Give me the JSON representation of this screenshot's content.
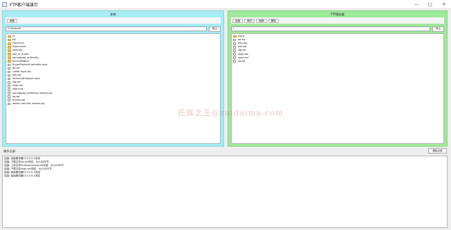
{
  "window": {
    "title": "FTP客户端演示",
    "controls": {
      "minimize": "—",
      "maximize": "□",
      "close": "✕"
    }
  },
  "local": {
    "title": "本地",
    "toolbar": [
      "刷新"
    ],
    "path": "D:\\idework",
    "up_label": "向上",
    "items": [
      {
        "name": "cc",
        "icon": "folder-icon"
      },
      {
        "name": "E6",
        "icon": "folder-icon"
      },
      {
        "name": "FtpClient",
        "icon": "folder-icon"
      },
      {
        "name": "ftpreceiver",
        "icon": "folder-icon"
      },
      {
        "name": "sellmao",
        "icon": "folder-icon"
      },
      {
        "name": "sell_m_finest",
        "icon": "folder-icon"
      },
      {
        "name": "springboot_authority",
        "icon": "folder-icon"
      },
      {
        "name": "SpringProject",
        "icon": "folder-icon"
      },
      {
        "name": "BuyerProductController.java",
        "icon": "file-icon"
      },
      {
        "name": "dd.txt",
        "icon": "file-icon"
      },
      {
        "name": "i-fetal-layui.zip",
        "icon": "file-icon"
      },
      {
        "name": "sell.sql",
        "icon": "file-icon"
      },
      {
        "name": "SellerAuthAspect.java",
        "icon": "file-icon"
      },
      {
        "name": "sfg.txt",
        "icon": "file-icon"
      },
      {
        "name": "shgh.txt",
        "icon": "file-icon"
      },
      {
        "name": "sport.txt",
        "icon": "file-icon"
      },
      {
        "name": "springboot_authority-master.zip",
        "icon": "file-icon"
      },
      {
        "name": "sq.sql",
        "icon": "file-icon"
      },
      {
        "name": "tickets.sql",
        "icon": "file-icon"
      },
      {
        "name": "weixin-sell-sell-master.zip",
        "icon": "file-icon"
      }
    ]
  },
  "remote": {
    "title": "FTP服务器",
    "toolbar": [
      "连接",
      "断开",
      "刷新",
      "删除"
    ],
    "path": "/",
    "up_label": "向上",
    "items": [
      {
        "name": "dwrg",
        "icon": "folder-icon"
      },
      {
        "name": "dd.txt",
        "icon": "file-icon"
      },
      {
        "name": "oos.doc",
        "icon": "file-icon"
      },
      {
        "name": "sell.sql",
        "icon": "file-icon"
      },
      {
        "name": "sfg.txt",
        "icon": "file-icon"
      },
      {
        "name": "shgh.txt",
        "icon": "file-icon"
      },
      {
        "name": "sport.txt",
        "icon": "file-icon"
      },
      {
        "name": "sq.sql",
        "icon": "file-icon"
      }
    ]
  },
  "watermark": "氏族之王@zuidaima.com",
  "log": {
    "label": "操作记录:",
    "clear_label": "清除记录",
    "lines": [
      "连接: 连接服务器127.0.0.1完成",
      "连接: 下载文件dd.txt完成，大小38字节",
      "连接: 上传文件D:\\idework\\sfg.txt完成，大小23字节",
      "连接: 下载文件shgh.txt完成，大小45字节",
      "连接: 刷新服务器127.0.0.1完成",
      "连接: 连接服务器127.0.0.1完成"
    ]
  }
}
